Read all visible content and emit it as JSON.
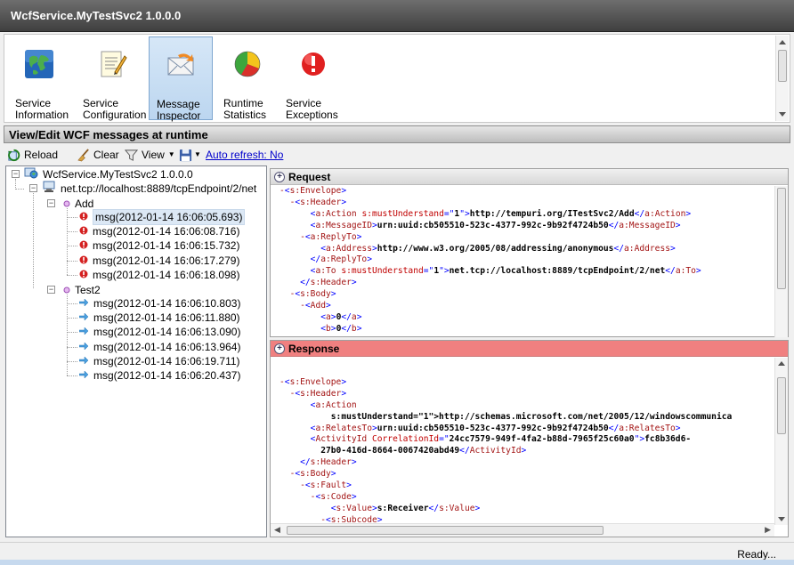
{
  "window": {
    "title": "WcfService.MyTestSvc2 1.0.0.0"
  },
  "ribbon": {
    "buttons": [
      {
        "label": "Service\nInformation",
        "icon": "globe-icon"
      },
      {
        "label": "Service\nConfiguration",
        "icon": "config-sheet-icon"
      },
      {
        "label": "Message\nInspector",
        "icon": "envelope-icon",
        "selected": true
      },
      {
        "label": "Runtime\nStatistics",
        "icon": "pie-chart-icon"
      },
      {
        "label": "Service\nExceptions",
        "icon": "exclamation-icon"
      }
    ]
  },
  "section": {
    "title": "View/Edit WCF messages at runtime"
  },
  "toolbar": {
    "reload_label": "Reload",
    "clear_label": "Clear",
    "view_label": "View",
    "auto_refresh_label": "Auto refresh: No"
  },
  "tree": {
    "root": "WcfService.MyTestSvc2 1.0.0.0",
    "endpoint": "net.tcp://localhost:8889/tcpEndpoint/2/net",
    "operations": [
      {
        "name": "Add",
        "messages": [
          "msg(2012-01-14 16:06:05.693)",
          "msg(2012-01-14 16:06:08.716)",
          "msg(2012-01-14 16:06:15.732)",
          "msg(2012-01-14 16:06:17.279)",
          "msg(2012-01-14 16:06:18.098)"
        ],
        "status": "error"
      },
      {
        "name": "Test2",
        "messages": [
          "msg(2012-01-14 16:06:10.803)",
          "msg(2012-01-14 16:06:11.880)",
          "msg(2012-01-14 16:06:13.090)",
          "msg(2012-01-14 16:06:13.964)",
          "msg(2012-01-14 16:06:19.711)",
          "msg(2012-01-14 16:06:20.437)"
        ],
        "status": "ok"
      }
    ],
    "selected": "msg(2012-01-14 16:06:05.693)"
  },
  "request": {
    "title": "Request",
    "lines": [
      "-<s:Envelope>",
      "  -<s:Header>",
      "      <a:Action s:mustUnderstand=\"1\">http://tempuri.org/ITestSvc2/Add</a:Action>",
      "      <a:MessageID>urn:uuid:cb505510-523c-4377-992c-9b92f4724b50</a:MessageID>",
      "    -<a:ReplyTo>",
      "        <a:Address>http://www.w3.org/2005/08/addressing/anonymous</a:Address>",
      "      </a:ReplyTo>",
      "      <a:To s:mustUnderstand=\"1\">net.tcp://localhost:8889/tcpEndpoint/2/net</a:To>",
      "    </s:Header>",
      "  -<s:Body>",
      "    -<Add>",
      "        <a>0</a>",
      "        <b>0</b>"
    ]
  },
  "response": {
    "title": "Response",
    "header_color": "#f08080",
    "lines": [
      "",
      "-<s:Envelope>",
      "  -<s:Header>",
      "      <a:Action",
      "          s:mustUnderstand=\"1\">http://schemas.microsoft.com/net/2005/12/windowscommunica",
      "      <a:RelatesTo>urn:uuid:cb505510-523c-4377-992c-9b92f4724b50</a:RelatesTo>",
      "      <ActivityId CorrelationId=\"24cc7579-949f-4fa2-b88d-7965f25c60a0\">fc8b36d6-",
      "        27b0-416d-8664-0067420abd49</ActivityId>",
      "    </s:Header>",
      "  -<s:Body>",
      "    -<s:Fault>",
      "      -<s:Code>",
      "          <s:Value>s:Receiver</s:Value>",
      "        -<s:Subcode>"
    ]
  },
  "status": {
    "text": "Ready..."
  }
}
